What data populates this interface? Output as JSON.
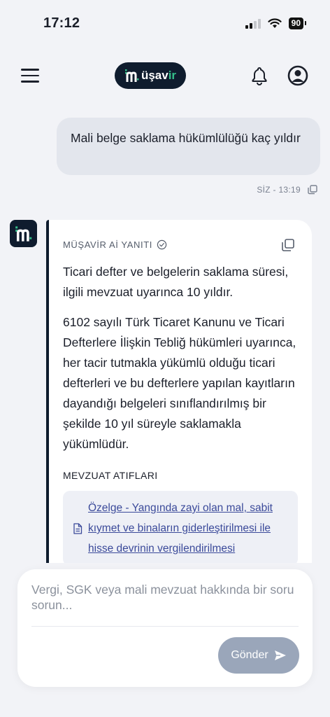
{
  "status": {
    "time": "17:12",
    "battery": "90"
  },
  "header": {
    "logo_prefix": "m",
    "logo_main": "üşav",
    "logo_accent": "ir"
  },
  "user_message": {
    "text": "Mali belge saklama hükümlülüğü kaç yıldır",
    "meta": "SİZ - 13:19"
  },
  "ai_response": {
    "label": "MÜŞAVİR Aİ YANITI",
    "paragraphs": [
      "Ticari defter ve belgelerin saklama süresi, ilgili mevzuat uyarınca 10 yıldır.",
      "6102 sayılı Türk Ticaret Kanunu ve Ticari Defterlere İlişkin Tebliğ hükümleri uyarınca, her tacir tutmakla yükümlü olduğu ticari defterleri ve bu defterlere yapılan kayıtların dayandığı belgeleri sınıflandırılmış bir şekilde 10 yıl süreyle saklamakla yükümlüdür."
    ],
    "references_heading": "MEVZUAT ATIFLARI",
    "references": [
      "Özelge - Yangında zayi olan mal, sabit kıymet ve binaların giderleştirilmesi ile hisse devrinin vergilendirilmesi"
    ]
  },
  "composer": {
    "placeholder": "Vergi, SGK veya mali mevzuat hakkında bir soru sorun...",
    "value": "",
    "send_label": "Gönder"
  },
  "colors": {
    "brand_dark": "#0f1c2e",
    "brand_accent": "#35c08b",
    "send_button": "#9aa6ba",
    "link": "#3b4a9a"
  },
  "icons": [
    "menu-icon",
    "bell-icon",
    "user-icon",
    "copy-icon",
    "check-circle-icon",
    "document-icon",
    "send-icon"
  ]
}
